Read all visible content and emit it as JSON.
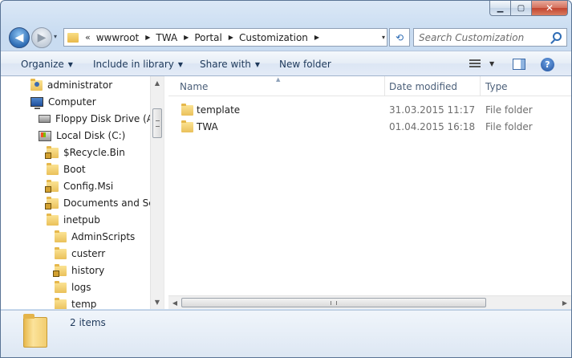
{
  "window": {
    "caption": {
      "minimize": "▁",
      "maximize": "▢",
      "close": "✕"
    }
  },
  "nav": {
    "back": "◀",
    "forward": "▶",
    "history": "▾",
    "address_prefix": "«",
    "breadcrumb": [
      "wwwroot",
      "TWA",
      "Portal",
      "Customization"
    ],
    "dropdown": "▾",
    "refresh": "⟲"
  },
  "search": {
    "placeholder": "Search Customization"
  },
  "toolbar": {
    "organize": "Organize",
    "include_in_library": "Include in library",
    "share_with": "Share with",
    "new_folder": "New folder",
    "help": "?",
    "dropdown_arrow": "▼"
  },
  "tree": {
    "items": [
      {
        "label": "administrator",
        "icon": "user-folder-icon"
      },
      {
        "label": "Computer",
        "icon": "computer-icon"
      },
      {
        "label": "Floppy Disk Drive (A:)",
        "icon": "floppy-icon"
      },
      {
        "label": "Local Disk (C:)",
        "icon": "disk-icon"
      },
      {
        "label": "$Recycle.Bin",
        "icon": "locked-folder-icon"
      },
      {
        "label": "Boot",
        "icon": "folder-icon"
      },
      {
        "label": "Config.Msi",
        "icon": "locked-folder-icon"
      },
      {
        "label": "Documents and Sett",
        "icon": "locked-folder-icon"
      },
      {
        "label": "inetpub",
        "icon": "folder-icon"
      },
      {
        "label": "AdminScripts",
        "icon": "folder-icon"
      },
      {
        "label": "custerr",
        "icon": "folder-icon"
      },
      {
        "label": "history",
        "icon": "locked-folder-icon"
      },
      {
        "label": "logs",
        "icon": "folder-icon"
      },
      {
        "label": "temp",
        "icon": "folder-icon"
      }
    ]
  },
  "scroll": {
    "up": "▲",
    "down": "▼",
    "left": "◀",
    "right": "▶"
  },
  "list": {
    "columns": {
      "name": "Name",
      "date": "Date modified",
      "type": "Type"
    },
    "sort_indicator": "▲",
    "rows": [
      {
        "name": "template",
        "date": "31.03.2015 11:17",
        "type": "File folder"
      },
      {
        "name": "TWA",
        "date": "01.04.2015 16:18",
        "type": "File folder"
      }
    ]
  },
  "details": {
    "item_count": "2 items"
  }
}
